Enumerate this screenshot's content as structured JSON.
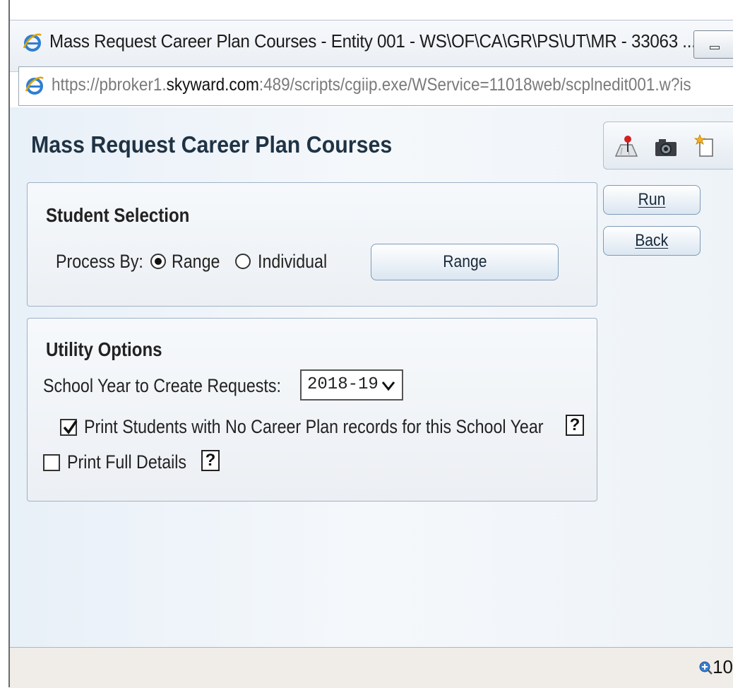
{
  "window": {
    "title": "Mass Request Career Plan Courses - Entity 001 - WS\\OF\\CA\\GR\\PS\\UT\\MR - 33063 ...",
    "url_prefix": "https://pbroker1.",
    "url_domain": "skyward.com",
    "url_rest": ":489/scripts/cgiip.exe/WService=11018web/scplnedit001.w?is"
  },
  "page": {
    "title": "Mass Request Career Plan Courses"
  },
  "toolbar": {
    "icons": [
      "map-pin-icon",
      "camera-icon",
      "new-item-icon"
    ]
  },
  "actions": {
    "run_label": "Run",
    "back_label": "Back"
  },
  "student_selection": {
    "heading": "Student Selection",
    "process_by_label": "Process By:",
    "options": [
      {
        "label": "Range",
        "selected": true
      },
      {
        "label": "Individual",
        "selected": false
      }
    ],
    "range_button_label": "Range"
  },
  "utility_options": {
    "heading": "Utility Options",
    "school_year_label": "School Year to Create Requests:",
    "school_year_value": "2018-19",
    "print_no_career_plan_label": "Print Students with No Career Plan records for this School Year",
    "print_no_career_plan_checked": true,
    "print_full_details_label": "Print Full Details",
    "print_full_details_checked": false,
    "help_glyph": "?"
  },
  "statusbar": {
    "zoom_text": "10"
  },
  "colors": {
    "ie_blue": "#2f7fd1",
    "panel_border": "#9fb2c6",
    "title_text": "#1f3344"
  }
}
